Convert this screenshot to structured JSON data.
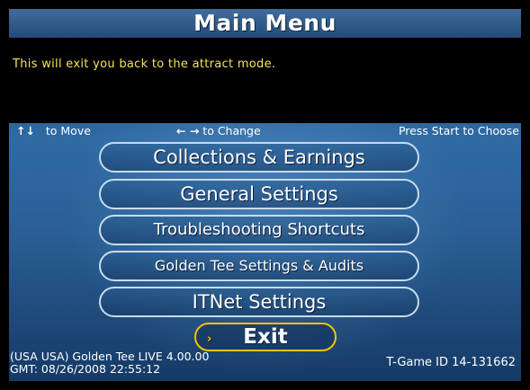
{
  "title": "Main Menu",
  "message": "This will exit you back to the attract mode.",
  "hints": {
    "move_icon": "up-down-arrows",
    "move_arrows": "↑↓",
    "move": "to Move",
    "change_icon": "left-right-arrows",
    "change_arrows": "← →",
    "change": "to Change",
    "choose": "Press Start to Choose"
  },
  "menu": {
    "items": [
      {
        "label": "Collections & Earnings"
      },
      {
        "label": "General Settings"
      },
      {
        "label": "Troubleshooting Shortcuts"
      },
      {
        "label": "Golden Tee Settings & Audits"
      },
      {
        "label": "ITNet Settings"
      }
    ],
    "exit": {
      "label": "Exit",
      "selected": true,
      "marker_icon": "selection-arrow"
    }
  },
  "footer": {
    "version": "(USA USA) Golden Tee LIVE 4.00.00",
    "gmt": "GMT: 08/26/2008 22:55:12",
    "game_id": "T-Game ID 14-131662"
  },
  "colors": {
    "message_text": "#f2e35a",
    "selected_border": "#f2c400",
    "button_border": "#c7dcee",
    "background": "#2a5f95"
  }
}
